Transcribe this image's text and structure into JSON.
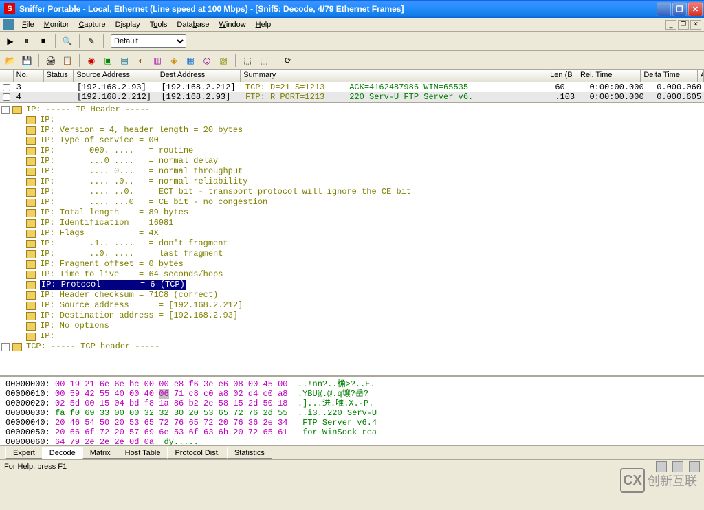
{
  "window": {
    "title": "Sniffer Portable - Local, Ethernet (Line speed at 100 Mbps) - [Snif5: Decode, 4/79 Ethernet Frames]"
  },
  "menu": {
    "items": [
      "File",
      "Monitor",
      "Capture",
      "Display",
      "Tools",
      "Database",
      "Window",
      "Help"
    ]
  },
  "toolbar1": {
    "filter_default": "Default"
  },
  "frame_cols": {
    "no": "No.",
    "status": "Status",
    "src": "Source Address",
    "dest": "Dest Address",
    "summary": "Summary",
    "len": "Len (B",
    "rel": "Rel. Time",
    "delta": "Delta Time",
    "abs": "Abs. Time"
  },
  "frames": [
    {
      "no": "3",
      "status": "",
      "src": "[192.168.2.93]",
      "dest": "[192.168.2.212]",
      "summary_a": "TCP: D=21 S=1213",
      "summary_b": "ACK=4162487986 WIN=65535",
      "len": "60",
      "rel": "0:00:00.000",
      "delta": "0.000.060"
    },
    {
      "no": "4",
      "status": "",
      "src": "[192.168.2.212]",
      "dest": "[192.168.2.93]",
      "summary_a": "FTP: R PORT=1213",
      "summary_b": "220 Serv-U FTP Server v6.",
      "len": ".103",
      "rel": "0:00:00.000",
      "delta": "0.000.605"
    }
  ],
  "decode": {
    "lines": [
      {
        "level": 0,
        "toggle": "-",
        "icon": "filter",
        "text": "IP: ----- IP Header -----"
      },
      {
        "level": 1,
        "icon": "folder",
        "text": "IP:"
      },
      {
        "level": 1,
        "icon": "folder",
        "text": "IP: Version = 4, header length = 20 bytes"
      },
      {
        "level": 1,
        "icon": "folder",
        "text": "IP: Type of service = 00"
      },
      {
        "level": 1,
        "icon": "folder",
        "text": "IP:       000. ....   = routine"
      },
      {
        "level": 1,
        "icon": "folder",
        "text": "IP:       ...0 ....   = normal delay"
      },
      {
        "level": 1,
        "icon": "folder",
        "text": "IP:       .... 0...   = normal throughput"
      },
      {
        "level": 1,
        "icon": "folder",
        "text": "IP:       .... .0..   = normal reliability"
      },
      {
        "level": 1,
        "icon": "folder",
        "text": "IP:       .... ..0.   = ECT bit - transport protocol will ignore the CE bit"
      },
      {
        "level": 1,
        "icon": "folder",
        "text": "IP:       .... ...0   = CE bit - no congestion"
      },
      {
        "level": 1,
        "icon": "folder",
        "text": "IP: Total length    = 89 bytes"
      },
      {
        "level": 1,
        "icon": "folder",
        "text": "IP: Identification  = 16981"
      },
      {
        "level": 1,
        "icon": "folder",
        "text": "IP: Flags           = 4X"
      },
      {
        "level": 1,
        "icon": "folder",
        "text": "IP:       .1.. ....   = don't fragment"
      },
      {
        "level": 1,
        "icon": "folder",
        "text": "IP:       ..0. ....   = last fragment"
      },
      {
        "level": 1,
        "icon": "folder",
        "text": "IP: Fragment offset = 0 bytes"
      },
      {
        "level": 1,
        "icon": "folder",
        "text": "IP: Time to live    = 64 seconds/hops"
      },
      {
        "level": 1,
        "icon": "folder",
        "text": "IP: Protocol        = 6 (TCP)",
        "selected": true
      },
      {
        "level": 1,
        "icon": "folder",
        "text": "IP: Header checksum = 71C8 (correct)"
      },
      {
        "level": 1,
        "icon": "folder",
        "text": "IP: Source address      = [192.168.2.212]"
      },
      {
        "level": 1,
        "icon": "folder",
        "text": "IP: Destination address = [192.168.2.93]"
      },
      {
        "level": 1,
        "icon": "folder",
        "text": "IP: No options"
      },
      {
        "level": 1,
        "icon": "folder",
        "text": "IP:"
      },
      {
        "level": 0,
        "toggle": "-",
        "icon": "tcp",
        "text": "TCP: ----- TCP header -----"
      }
    ]
  },
  "hex": {
    "rows": [
      {
        "offset": "00000000:",
        "bytes": "00 19 21 6e 6e bc 00 00 e8 f6 3e e6 08 00 45 00",
        "ascii": "..!nn?..桷>?..E.",
        "cls": "b"
      },
      {
        "offset": "00000010:",
        "bytes": "00 59 42 55 40 00 40 <06> 71 c8 c0 a8 02 d4 c0 a8",
        "ascii": ".YBU@.@.q壤?岳?",
        "cls": "b"
      },
      {
        "offset": "00000020:",
        "bytes": "02 5d 00 15 04 bd f8 1a 86 b2 2e 58 15 2d 50 18",
        "ascii": ".]...进.唯.X.-P.",
        "cls": "b"
      },
      {
        "offset": "00000030:",
        "bytes": "fa f0 69 33 00 00 32 32 30 20 53 65 72 76 2d 55",
        "ascii": "..i3..220 Serv-U",
        "cls": "b2"
      },
      {
        "offset": "00000040:",
        "bytes": "20 46 54 50 20 53 65 72 76 65 72 20 76 36 2e 34",
        "ascii": " FTP Server v6.4",
        "cls": "b"
      },
      {
        "offset": "00000050:",
        "bytes": "20 66 6f 72 20 57 69 6e 53 6f 63 6b 20 72 65 61",
        "ascii": " for WinSock rea",
        "cls": "b"
      },
      {
        "offset": "00000060:",
        "bytes": "64 79 2e 2e 2e 0d 0a",
        "ascii": "dy.....",
        "cls": "b"
      }
    ]
  },
  "tabs": {
    "items": [
      "Expert",
      "Decode",
      "Matrix",
      "Host Table",
      "Protocol Dist.",
      "Statistics"
    ],
    "active": 1
  },
  "status": {
    "helptext": "For Help, press F1"
  },
  "watermark": {
    "logo": "CX",
    "text": "创新互联"
  }
}
